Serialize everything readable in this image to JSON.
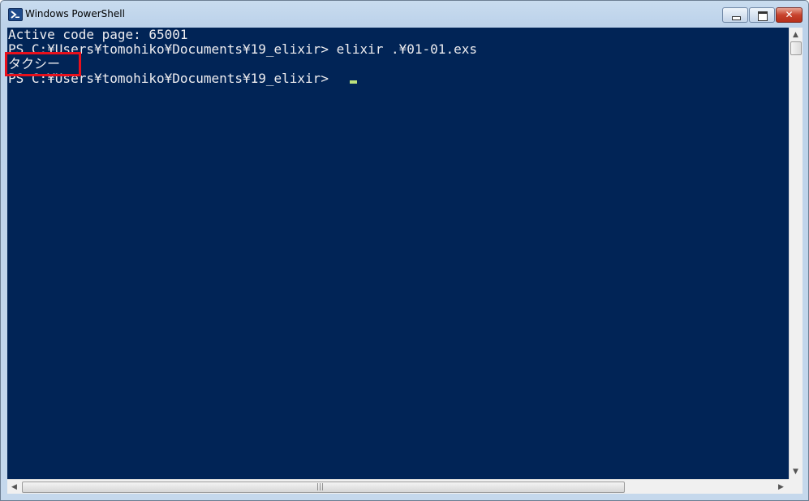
{
  "window": {
    "title": "Windows PowerShell",
    "icon": "powershell-icon",
    "controls": {
      "minimize": "minimize-icon",
      "maximize": "maximize-icon",
      "close": "✕"
    }
  },
  "console": {
    "background": "#012456",
    "text_color": "#eeedf0",
    "highlight_color": "#e8101c",
    "lines": [
      "Active code page: 65001",
      "PS C:¥Users¥tomohiko¥Documents¥19_elixir> elixir .¥01-01.exs",
      "タクシー",
      "PS C:¥Users¥tomohiko¥Documents¥19_elixir> "
    ]
  },
  "scrollbars": {
    "up": "▲",
    "down": "▼",
    "left": "◀",
    "right": "▶",
    "grip": "|||"
  }
}
